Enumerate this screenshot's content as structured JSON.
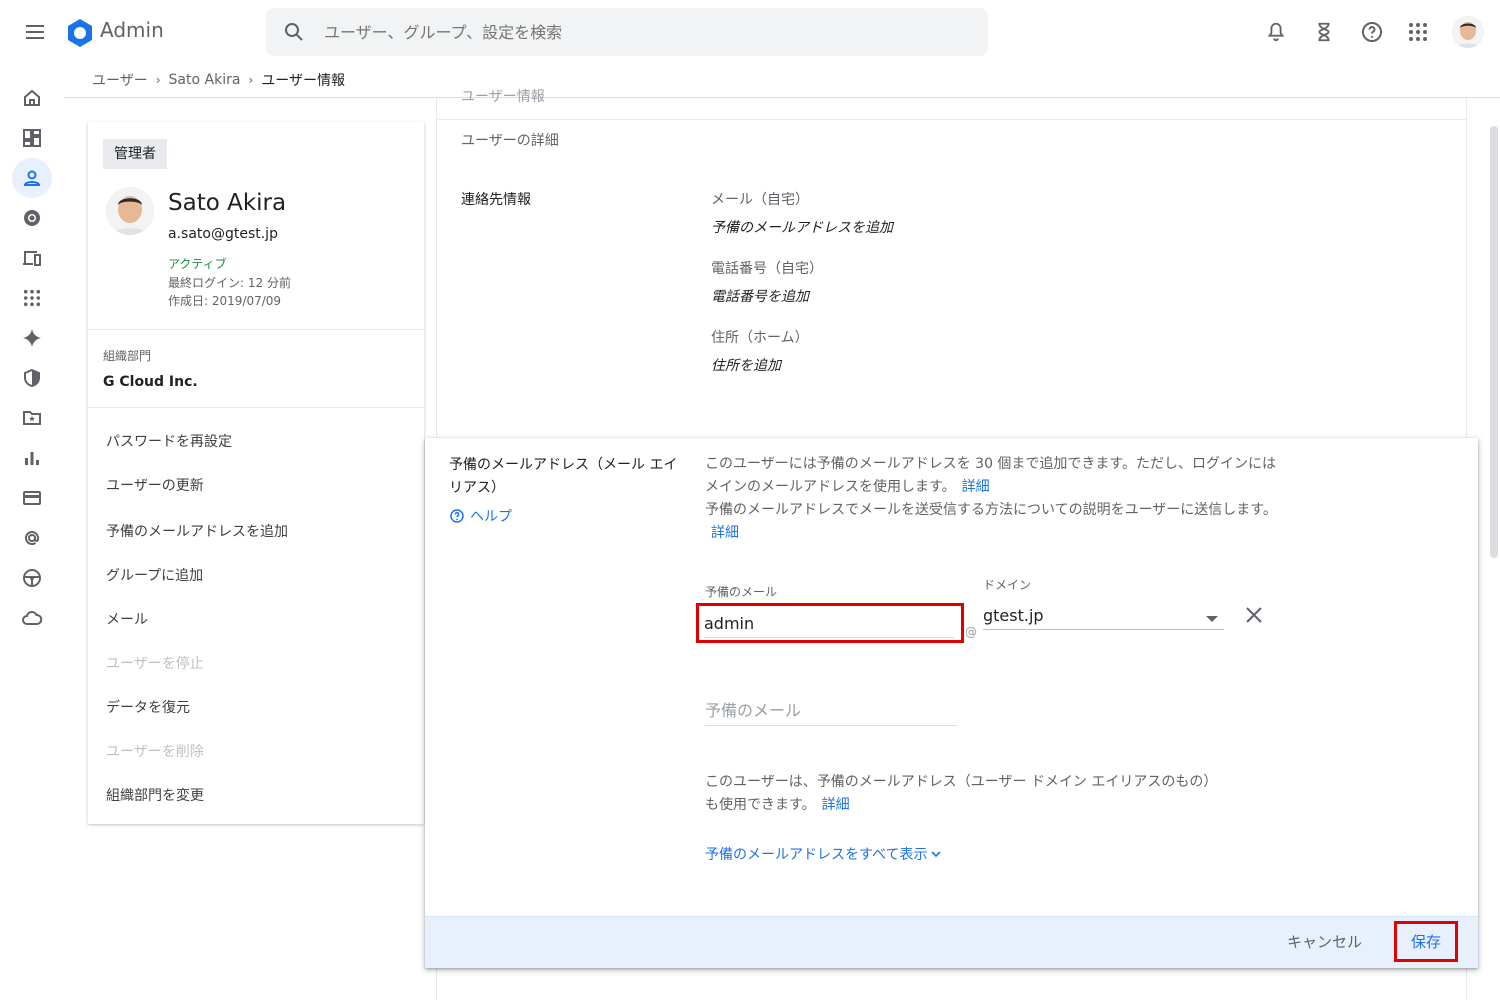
{
  "topbar": {
    "brand": "Admin",
    "search_placeholder": "ユーザー、グループ、設定を検索"
  },
  "breadcrumb": {
    "items": [
      "ユーザー",
      "Sato Akira",
      "ユーザー情報"
    ]
  },
  "user_card": {
    "role": "管理者",
    "name": "Sato Akira",
    "email": "a.sato@gtest.jp",
    "status": "アクティブ",
    "last_login": "最終ログイン: 12 分前",
    "created": "作成日: 2019/07/09",
    "org_label": "組織部門",
    "org_value": "G Cloud Inc.",
    "actions": [
      {
        "label": "パスワードを再設定",
        "enabled": true
      },
      {
        "label": "ユーザーの更新",
        "enabled": true
      },
      {
        "label": "予備のメールアドレスを追加",
        "enabled": true
      },
      {
        "label": "グループに追加",
        "enabled": true
      },
      {
        "label": "メール",
        "enabled": true
      },
      {
        "label": "ユーザーを停止",
        "enabled": false
      },
      {
        "label": "データを復元",
        "enabled": true
      },
      {
        "label": "ユーザーを削除",
        "enabled": false
      },
      {
        "label": "組織部門を変更",
        "enabled": true
      }
    ]
  },
  "details": {
    "partial_heading": "ユーザー情報",
    "section_title": "ユーザーの詳細",
    "contact_label": "連絡先情報",
    "fields": [
      {
        "label": "メール（自宅）",
        "add": "予備のメールアドレスを追加"
      },
      {
        "label": "電話番号（自宅）",
        "add": "電話番号を追加"
      },
      {
        "label": "住所（ホーム）",
        "add": "住所を追加"
      }
    ]
  },
  "dialog": {
    "title": "予備のメールアドレス（メール エイリアス）",
    "help": "ヘルプ",
    "desc1": "このユーザーには予備のメールアドレスを 30 個まで追加できます。ただし、ログインにはメインのメールアドレスを使用します。",
    "desc2": "予備のメールアドレスでメールを送受信する方法についての説明をユーザーに送信します。",
    "link_detail": "詳細",
    "alias_label": "予備のメール",
    "alias_value": "admin",
    "at": "@",
    "domain_label": "ドメイン",
    "domain_value": "gtest.jp",
    "alias2_placeholder": "予備のメール",
    "desc3": "このユーザーは、予備のメールアドレス（ユーザー ドメイン エイリアスのもの）も使用できます。",
    "show_all": "予備のメールアドレスをすべて表示",
    "cancel": "キャンセル",
    "save": "保存"
  },
  "colors": {
    "accent": "#1a73e8",
    "highlight": "#e00000",
    "status_active": "#1e8e3e",
    "footer_bg": "#e8f0fe"
  }
}
